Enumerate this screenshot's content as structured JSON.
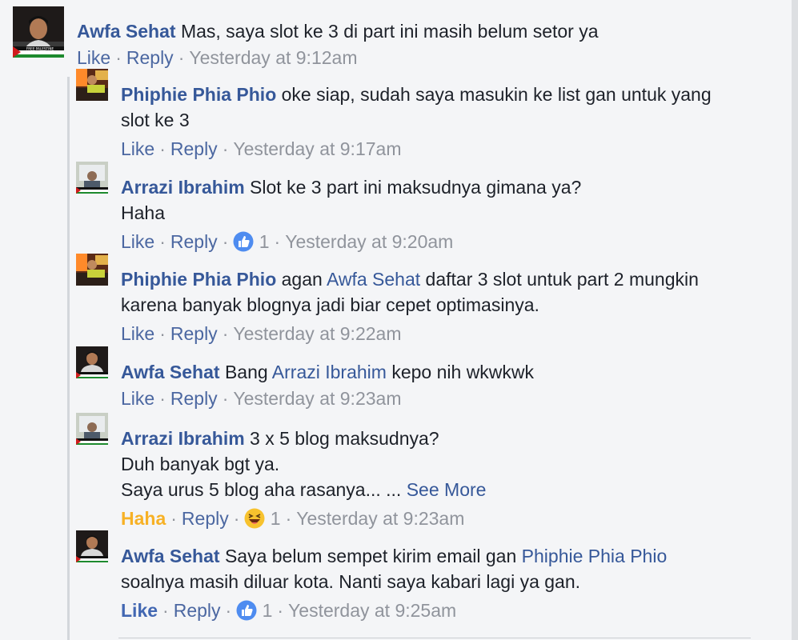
{
  "comments": [
    {
      "author": "Awfa Sehat",
      "text": "Mas, saya slot ke 3 di part ini masih belum setor ya",
      "like": "Like",
      "reply": "Reply",
      "time": "Yesterday at 9:12am"
    },
    {
      "author": "Phiphie Phia Phio",
      "text": "oke siap, sudah saya masukin ke list gan untuk yang slot ke 3",
      "like": "Like",
      "reply": "Reply",
      "time": "Yesterday at 9:17am"
    },
    {
      "author": "Arrazi Ibrahim",
      "line1": "Slot ke 3 part ini maksudnya gimana ya?",
      "line2": "Haha",
      "like": "Like",
      "reply": "Reply",
      "reaction_icon": "like-reaction-icon",
      "reaction_count": "1",
      "time": "Yesterday at 9:20am"
    },
    {
      "author": "Phiphie Phia Phio",
      "pre": "agan",
      "mention": "Awfa Sehat",
      "post": "daftar 3 slot untuk part 2 mungkin karena banyak blognya jadi biar cepet optimasinya.",
      "like": "Like",
      "reply": "Reply",
      "time": "Yesterday at 9:22am"
    },
    {
      "author": "Awfa Sehat",
      "pre": "Bang",
      "mention": "Arrazi Ibrahim",
      "post": "kepo nih wkwkwk",
      "like": "Like",
      "reply": "Reply",
      "time": "Yesterday at 9:23am"
    },
    {
      "author": "Arrazi Ibrahim",
      "line1": "3 x 5 blog maksudnya?",
      "line2": "Duh banyak bgt ya.",
      "line3": "Saya urus 5 blog aha rasanya... ...",
      "see_more": "See More",
      "like": "Haha",
      "reply": "Reply",
      "reaction_icon": "haha-reaction-icon",
      "reaction_count": "1",
      "time": "Yesterday at 9:23am"
    },
    {
      "author": "Awfa Sehat",
      "pre": "Saya belum sempet kirim email gan",
      "mention": "Phiphie Phia Phio",
      "post": "soalnya masih diluar kota. Nanti saya kabari lagi ya gan.",
      "like": "Like",
      "reply": "Reply",
      "reaction_icon": "like-reaction-icon",
      "reaction_count": "1",
      "time": "Yesterday at 9:25am"
    }
  ],
  "avatar_banner_text": "FREE PALESTINE",
  "colors": {
    "author": "#365899",
    "meta": "#90949c",
    "like_active": "#4267b2",
    "haha_active": "#f7b125",
    "background": "#f4f5f7"
  }
}
